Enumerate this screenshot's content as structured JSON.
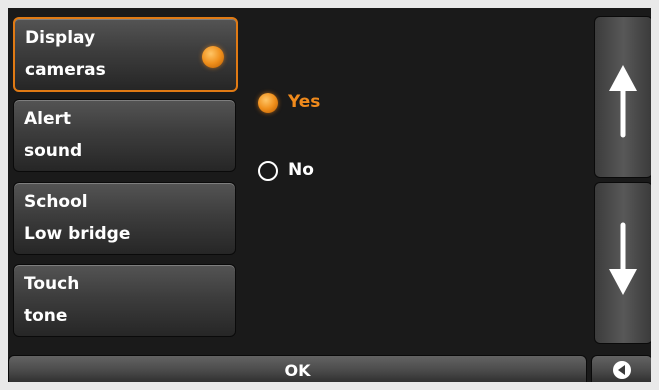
{
  "menu": [
    {
      "line1": "Display",
      "line2": "cameras",
      "active": true
    },
    {
      "line1": "Alert",
      "line2": "sound",
      "active": false
    },
    {
      "line1": "School",
      "line2": "Low bridge",
      "active": false
    },
    {
      "line1": "Touch",
      "line2": "tone",
      "active": false
    }
  ],
  "options": {
    "yes_label": "Yes",
    "no_label": "No",
    "selected": "Yes"
  },
  "scroll": {
    "up_icon": "arrow-up-icon",
    "down_icon": "arrow-down-icon"
  },
  "footer": {
    "ok_label": "OK",
    "back_icon": "back-icon"
  },
  "colors": {
    "accent": "#f08a1c",
    "background": "#1a1a1a",
    "frame": "#e9e9e9"
  }
}
